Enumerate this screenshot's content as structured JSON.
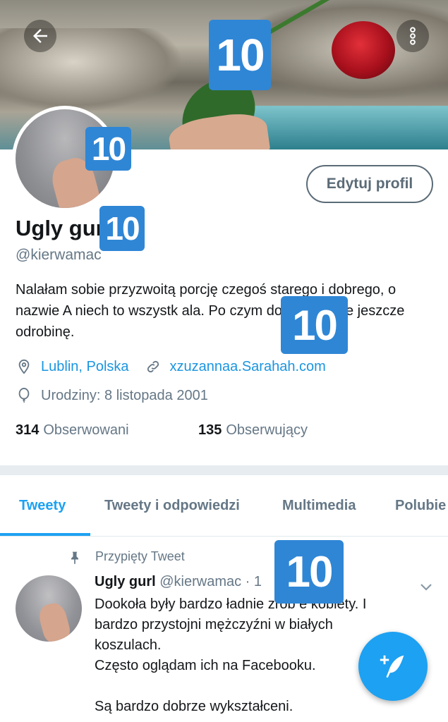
{
  "header": {
    "back_icon": "arrow-left-icon",
    "more_icon": "more-vertical-icon"
  },
  "badges": {
    "banner": "10",
    "avatar": "10",
    "name": "10",
    "bio": "10",
    "tweet": "10"
  },
  "profile": {
    "edit_button": "Edytuj profil",
    "name": "Ugly gurl",
    "handle": "@kierwamac",
    "bio": "Nalałam sobie przyzwoitą porcję czegoś starego i dobrego, o nazwie A niech to wszystko szlag trafi, i zaniedbała. Po czym dolałam sobie jeszcze odrobinę.",
    "bio_visible": "Nalałam sobie przyzwoitą porcję czegoś starego i dobrego, o nazwie A niech to wszystk            ala. Po czym dolałam sobie jeszcze odrobinę.",
    "location": "Lublin, Polska",
    "website": "xzuzannaa.Sarahah.com",
    "birthday": "Urodziny: 8 listopada 2001",
    "following_count": "314",
    "following_label": "Obserwowani",
    "followers_count": "135",
    "followers_label": "Obserwujący"
  },
  "tabs": [
    {
      "label": "Tweety"
    },
    {
      "label": "Tweety i odpowiedzi"
    },
    {
      "label": "Multimedia"
    },
    {
      "label": "Polubie"
    }
  ],
  "pinned": {
    "label": "Przypięty Tweet",
    "author_name": "Ugly gurl",
    "author_handle": "@kierwamac · 1",
    "text": "Dookoła były bardzo ładnie zrob      e kobiety. I\nbardzo przystojni mężczyźni w białych\nkoszulach.\nCzęsto oglądam ich na Facebooku.\n\nSą bardzo dobrze wykształceni."
  },
  "colors": {
    "accent": "#1da1f2",
    "link": "#1b95e0",
    "muted": "#657786",
    "badge": "#2f86d5"
  }
}
